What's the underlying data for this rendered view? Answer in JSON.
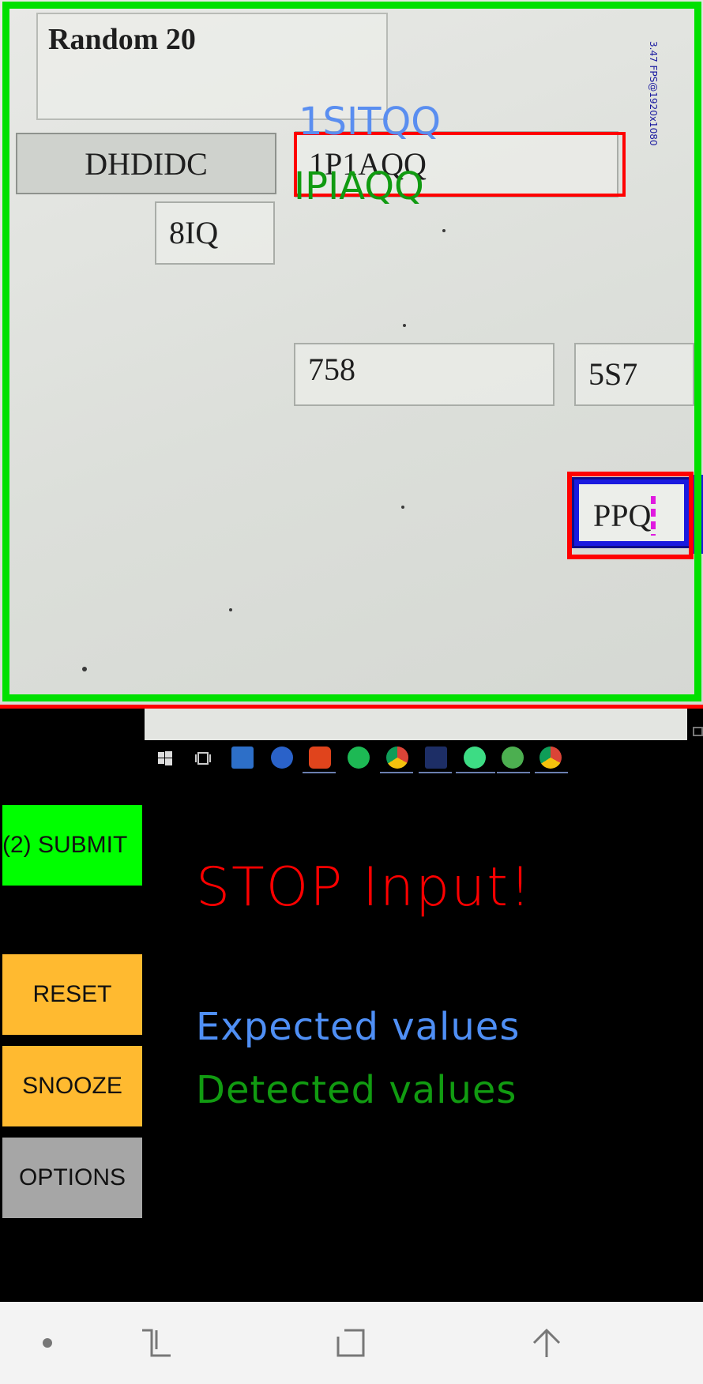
{
  "camera_view": {
    "form_title": "Random 20",
    "button_label": "DHDIDC",
    "fields": {
      "field_top": "1P1AQQ",
      "field_small": "8IQ",
      "field_mid": "758",
      "field_right": "5S7",
      "field_active": "PPQ"
    },
    "overlay": {
      "expected_value": "1SITQQ",
      "detected_value": "IPIAQQ"
    },
    "fps_label": "3.47 FPS@1920x1080"
  },
  "taskbar_icons": [
    "windows-start-icon",
    "task-view-icon",
    "app-icon",
    "r-icon",
    "ubuntu-icon",
    "spotify-icon",
    "chrome-icon",
    "tex-icon",
    "android-studio-icon",
    "app-icon",
    "chrome-icon"
  ],
  "controls": {
    "submit_label": "(2) SUBMIT",
    "reset_label": "RESET",
    "snooze_label": "SNOOZE",
    "options_label": "OPTIONS"
  },
  "hud": {
    "stop_text": "STOP Input!",
    "expected_legend": "Expected values",
    "detected_legend": "Detected values"
  },
  "colors": {
    "frame_green": "#00e000",
    "alert_red": "#ff0000",
    "expected_blue": "#4f8ff5",
    "detected_green": "#119b11",
    "submit_green": "#00ff00",
    "reset_orange": "#ffba30",
    "options_gray": "#a6a6a6"
  },
  "navbar": [
    "dot-icon",
    "recent-apps-icon",
    "home-icon",
    "back-icon"
  ]
}
